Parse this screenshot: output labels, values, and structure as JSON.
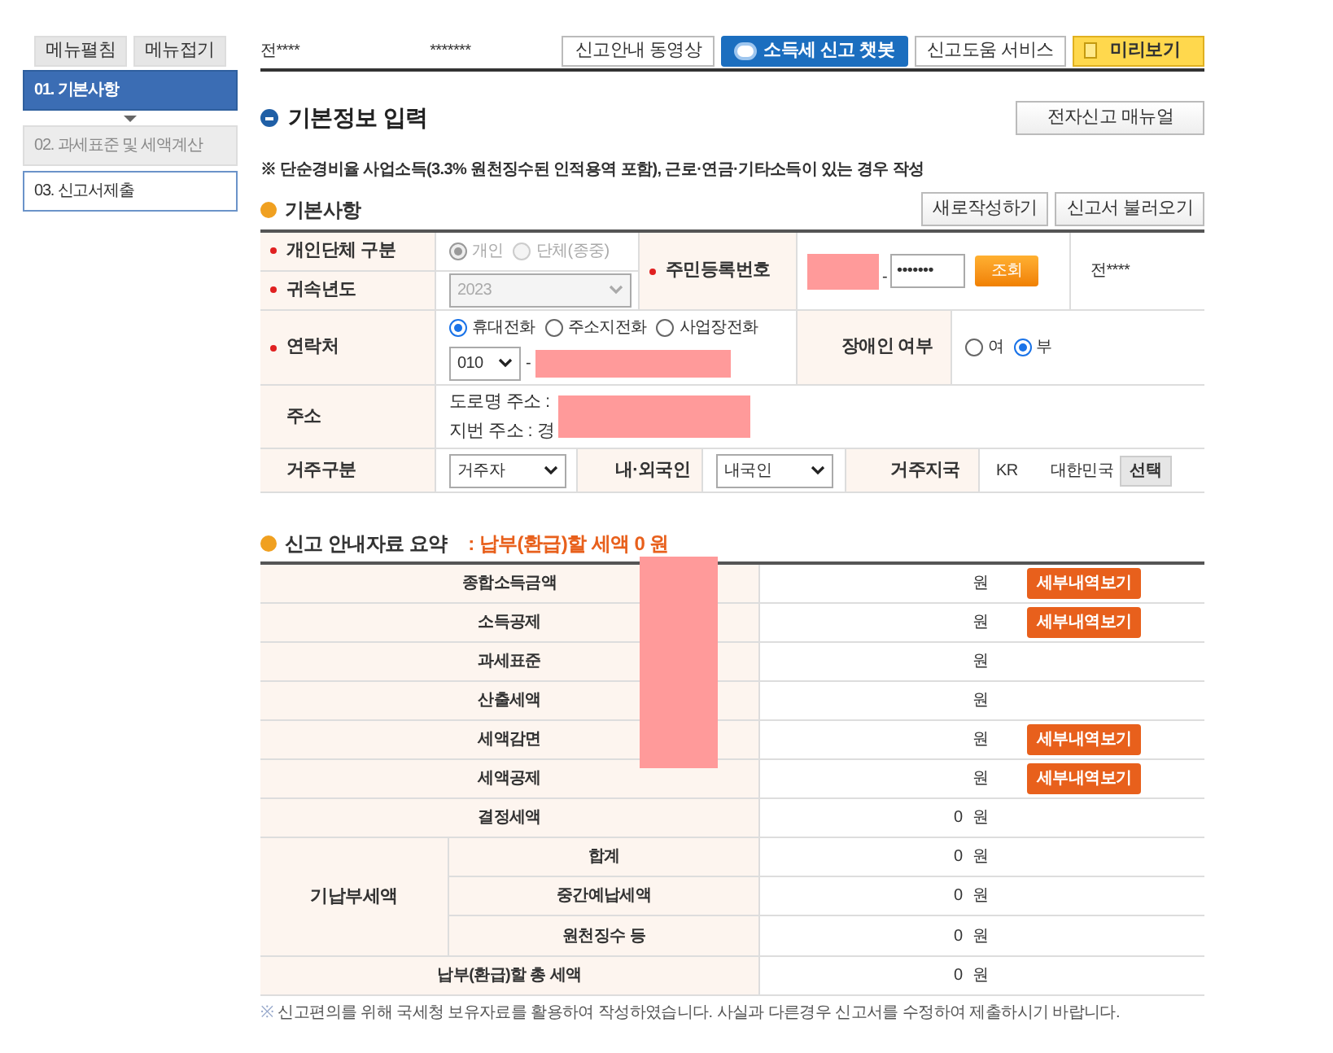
{
  "sidebar": {
    "buttons": [
      "메뉴펼침",
      "메뉴접기"
    ],
    "steps": [
      {
        "label": "01. 기본사항",
        "selected": true,
        "disabled": false
      },
      {
        "label": "02. 과세표준 및 세액계산",
        "selected": false,
        "disabled": true
      },
      {
        "label": "03. 신고서제출",
        "selected": false,
        "disabled": false
      }
    ]
  },
  "header": {
    "user": "전****",
    "masked": "*******"
  },
  "top_buttons": [
    {
      "label": "신고안내 동영상",
      "kind": "plain"
    },
    {
      "label": "소득세 신고 챗봇",
      "kind": "chatbot"
    },
    {
      "label": "신고도움 서비스",
      "kind": "plain"
    },
    {
      "label": "미리보기",
      "kind": "preview"
    }
  ],
  "page_title": "기본정보 입력",
  "manual_button": "전자신고 매뉴얼",
  "notice": "※ 단순경비율 사업소득(3.3% 원천징수된 인적용역 포함), 근로·연금·기타소득이 있는 경우 작성",
  "basic": {
    "title": "기본사항",
    "buttons": [
      "새로작성하기",
      "신고서 불러오기"
    ],
    "taxpayer_type": {
      "label": "개인단체 구분",
      "required": true,
      "disabled": true,
      "options": [
        {
          "label": "개인",
          "selected": true
        },
        {
          "label": "단체(종중)",
          "selected": false
        }
      ]
    },
    "year": {
      "label": "귀속년도",
      "required": true,
      "value": "2023",
      "disabled": true
    },
    "resident_number": {
      "label": "주민등록번호",
      "required": true,
      "back": "•••••••",
      "button": "조회",
      "name": "전****"
    },
    "contact": {
      "label": "연락처",
      "required": true,
      "options": [
        {
          "label": "휴대전화",
          "selected": true
        },
        {
          "label": "주소지전화",
          "selected": false
        },
        {
          "label": "사업장전화",
          "selected": false
        }
      ],
      "prefix": "010",
      "separator": "-"
    },
    "disabled_person": {
      "label": "장애인 여부",
      "options": [
        {
          "label": "여",
          "selected": false
        },
        {
          "label": "부",
          "selected": true
        }
      ]
    },
    "address": {
      "label": "주소",
      "road": "도로명 주소 :",
      "lot": "지번 주소 :",
      "lot_value": "경"
    },
    "residence": {
      "label": "거주구분",
      "value": "거주자"
    },
    "nationality": {
      "label": "내·외국인",
      "value": "내국인"
    },
    "country": {
      "label": "거주지국",
      "code": "KR",
      "name": "대한민국",
      "button": "선택"
    }
  },
  "summary": {
    "title": "신고 안내자료 요약",
    "result": ": 납부(환급)할 세액 0 원",
    "rows": [
      {
        "label": "종합소득금액",
        "unit": "원",
        "detail_button": "세부내역보기"
      },
      {
        "label": "소득공제",
        "unit": "원",
        "detail_button": "세부내역보기"
      },
      {
        "label": "과세표준",
        "unit": "원"
      },
      {
        "label": "산출세액",
        "unit": "원"
      },
      {
        "label": "세액감면",
        "unit": "원",
        "detail_button": "세부내역보기"
      },
      {
        "label": "세액공제",
        "unit": "원",
        "detail_button": "세부내역보기"
      },
      {
        "label": "결정세액",
        "amount": "0",
        "unit": "원"
      },
      {
        "label": "기납부세액",
        "children": [
          {
            "label": "합계",
            "amount": "0",
            "unit": "원"
          },
          {
            "label": "중간예납세액",
            "amount": "0",
            "unit": "원"
          },
          {
            "label": "원천징수 등",
            "amount": "0",
            "unit": "원"
          }
        ]
      },
      {
        "label": "납부(환급)할 총 세액",
        "amount": "0",
        "unit": "원"
      }
    ]
  },
  "footnote": {
    "mark": "※",
    "text": "신고편의를 위해 국세청 보유자료를 활용하여 작성하였습니다. 사실과 다른경우 신고서를 수정하여 제출하시기 바랍니다."
  }
}
